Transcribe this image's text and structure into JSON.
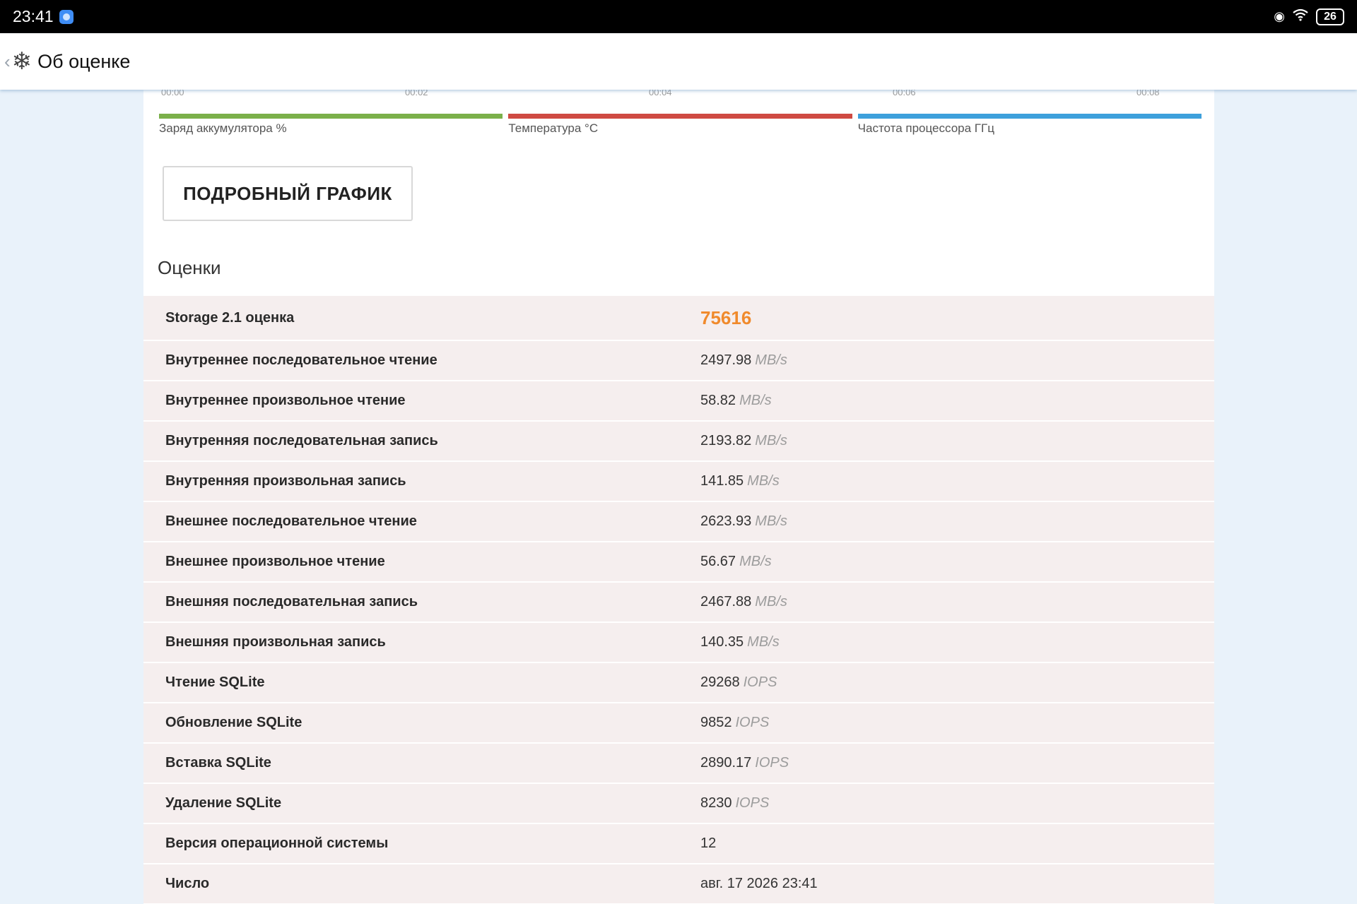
{
  "status_bar": {
    "time": "23:41",
    "battery": "26"
  },
  "header": {
    "title": "Об оценке"
  },
  "chart_axis": {
    "ticks": [
      "00:00",
      "00:02",
      "00:04",
      "00:06",
      "00:08"
    ]
  },
  "legend": [
    {
      "label": "Заряд аккумулятора %",
      "color": "#7bb04a"
    },
    {
      "label": "Температура °C",
      "color": "#cf4a42"
    },
    {
      "label": "Частота процессора ГГц",
      "color": "#3da0dc"
    }
  ],
  "detail_button": {
    "label": "ПОДРОБНЫЙ ГРАФИК"
  },
  "scores_section": {
    "title": "Оценки"
  },
  "scores": [
    {
      "label": "Storage 2.1 оценка",
      "value": "75616",
      "unit": ""
    },
    {
      "label": "Внутреннее последовательное чтение",
      "value": "2497.98",
      "unit": "MB/s"
    },
    {
      "label": "Внутреннее произвольное чтение",
      "value": "58.82",
      "unit": "MB/s"
    },
    {
      "label": "Внутренняя последовательная запись",
      "value": "2193.82",
      "unit": "MB/s"
    },
    {
      "label": "Внутренняя произвольная запись",
      "value": "141.85",
      "unit": "MB/s"
    },
    {
      "label": "Внешнее последовательное чтение",
      "value": "2623.93",
      "unit": "MB/s"
    },
    {
      "label": "Внешнее произвольное чтение",
      "value": "56.67",
      "unit": "MB/s"
    },
    {
      "label": "Внешняя последовательная запись",
      "value": "2467.88",
      "unit": "MB/s"
    },
    {
      "label": "Внешняя произвольная запись",
      "value": "140.35",
      "unit": "MB/s"
    },
    {
      "label": "Чтение SQLite",
      "value": "29268",
      "unit": "IOPS"
    },
    {
      "label": "Обновление SQLite",
      "value": "9852",
      "unit": "IOPS"
    },
    {
      "label": "Вставка SQLite",
      "value": "2890.17",
      "unit": "IOPS"
    },
    {
      "label": "Удаление SQLite",
      "value": "8230",
      "unit": "IOPS"
    },
    {
      "label": "Версия операционной системы",
      "value": "12",
      "unit": ""
    },
    {
      "label": "Число",
      "value": "авг. 17 2026 23:41",
      "unit": ""
    }
  ]
}
